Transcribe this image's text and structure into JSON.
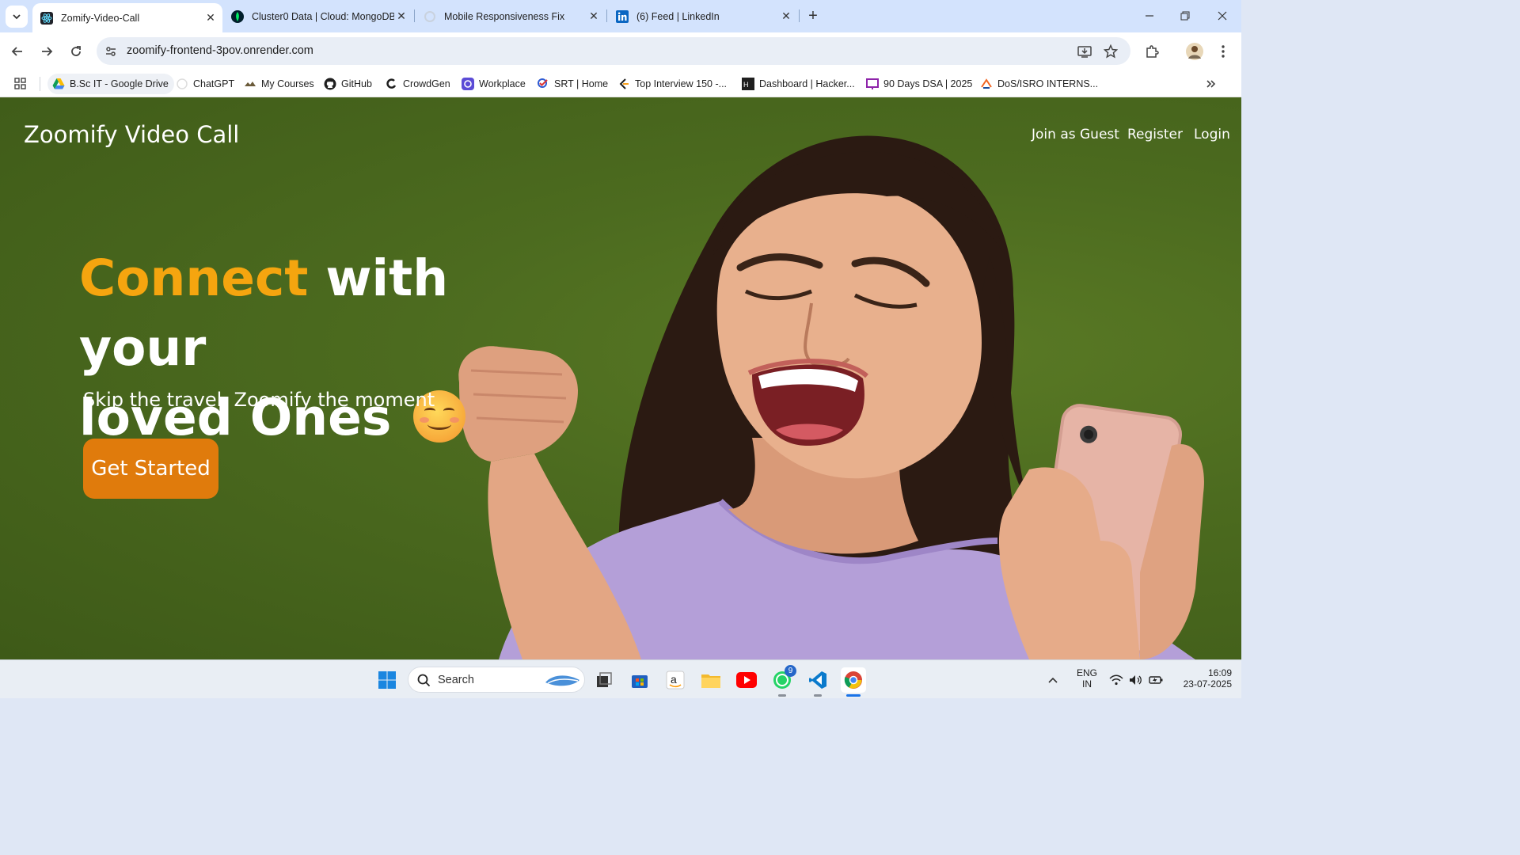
{
  "browser": {
    "tabs": [
      {
        "title": "Zomify-Video-Call",
        "active": true,
        "icon": "react-icon"
      },
      {
        "title": "Cluster0 Data | Cloud: MongoDB",
        "active": false,
        "icon": "mongodb-leaf-icon"
      },
      {
        "title": "Mobile Responsiveness Fix",
        "active": false,
        "icon": "openai-icon"
      },
      {
        "title": "(6) Feed | LinkedIn",
        "active": false,
        "icon": "linkedin-icon"
      }
    ],
    "url": "zoomify-frontend-3pov.onrender.com",
    "bookmarks": [
      {
        "label": "B.Sc IT - Google Drive",
        "icon": "google-drive-icon"
      },
      {
        "label": "ChatGPT",
        "icon": "chatgpt-icon"
      },
      {
        "label": "My Courses",
        "icon": "courses-icon"
      },
      {
        "label": "GitHub",
        "icon": "github-icon"
      },
      {
        "label": "CrowdGen",
        "icon": "crowdgen-icon"
      },
      {
        "label": "Workplace",
        "icon": "workplace-icon"
      },
      {
        "label": "SRT | Home",
        "icon": "srt-icon"
      },
      {
        "label": "Top Interview 150 -...",
        "icon": "leetcode-icon"
      },
      {
        "label": "Dashboard | Hacker...",
        "icon": "hackerrank-icon"
      },
      {
        "label": "90 Days DSA | 2025",
        "icon": "dsa-icon"
      },
      {
        "label": "DoS/ISRO INTERNS...",
        "icon": "isro-icon"
      }
    ]
  },
  "page": {
    "brand": "Zoomify Video Call",
    "nav": {
      "guest": "Join as Guest",
      "register": "Register",
      "login": "Login"
    },
    "hero": {
      "accent": "Connect",
      "rest_line1": " with your",
      "line2": "loved Ones",
      "emoji": "smiling-face-emoji",
      "subtitle": "Skip the travel, Zoomify the moment",
      "cta": "Get Started"
    },
    "colors": {
      "background": "#4c6b1f",
      "accent": "#f5a50f",
      "cta": "#e07b0c"
    }
  },
  "taskbar": {
    "search_label": "Search",
    "whatsapp_badge": "9",
    "language": "ENG",
    "region": "IN",
    "time": "16:09",
    "date": "23-07-2025"
  }
}
